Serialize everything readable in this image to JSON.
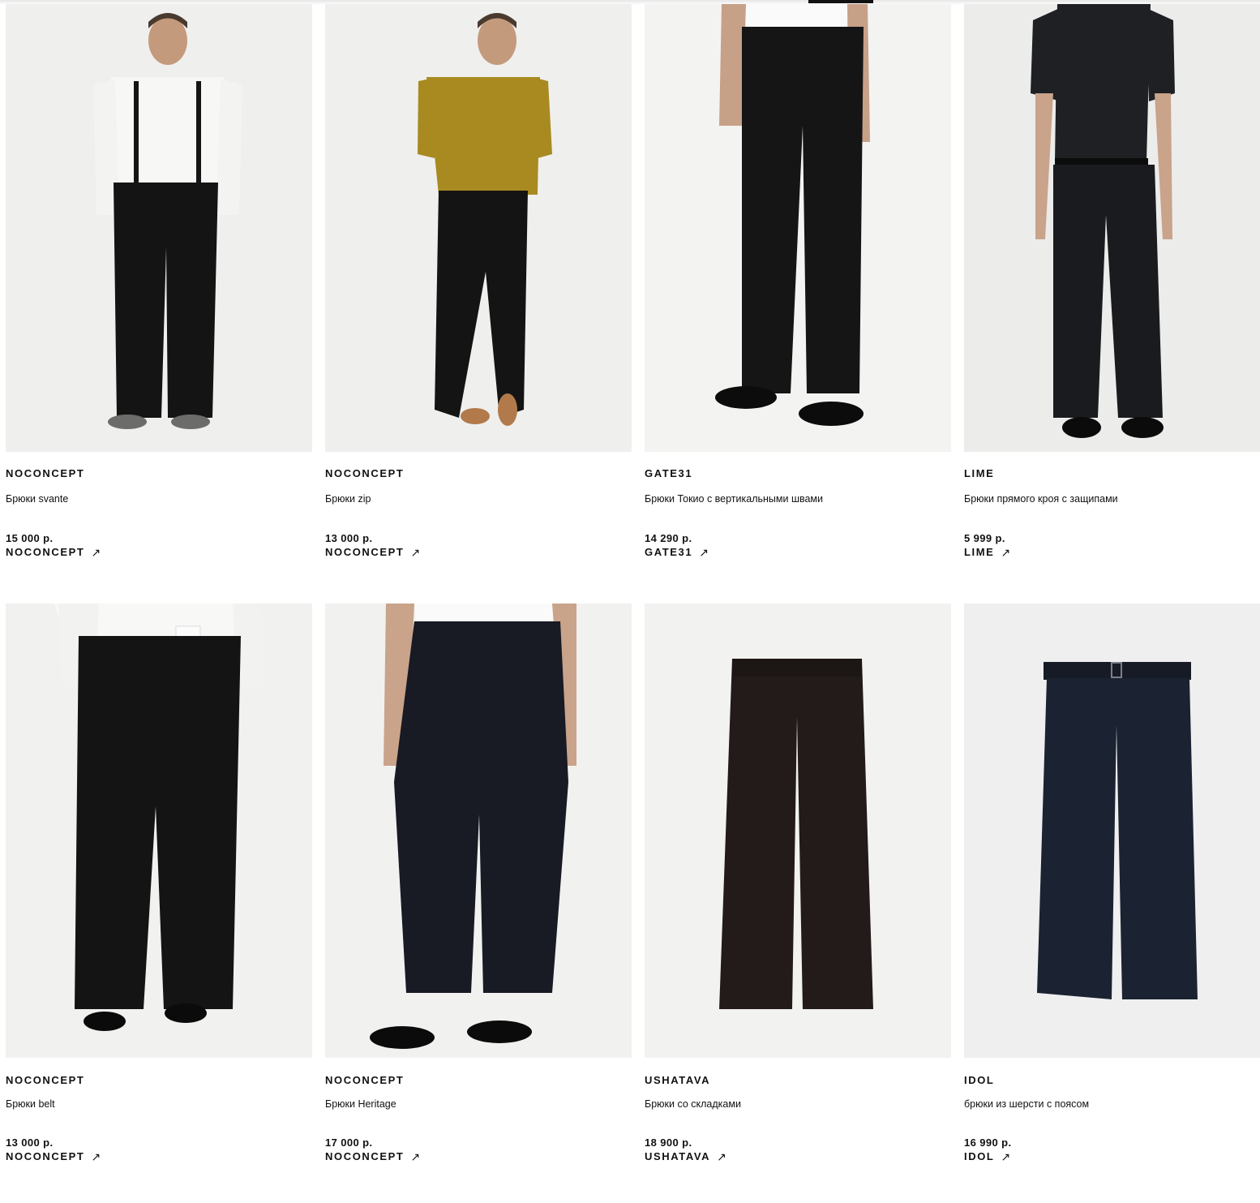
{
  "currency": "р.",
  "products": [
    {
      "brand": "NOCONCEPT",
      "name": "Брюки svante",
      "price": "15 000 р.",
      "shop_label": "NOCONCEPT",
      "photo": "model-white-shirt-suspenders-black-trousers"
    },
    {
      "brand": "NOCONCEPT",
      "name": "Брюки zip",
      "price": "13 000 р.",
      "shop_label": "NOCONCEPT",
      "photo": "model-mustard-tee-black-trousers"
    },
    {
      "brand": "GATE31",
      "name": "Брюки Токио с вертикальными швами",
      "price": "14 290 р.",
      "shop_label": "GATE31",
      "photo": "black-wide-trousers-waist-down"
    },
    {
      "brand": "LIME",
      "name": "Брюки прямого кроя с защипами",
      "price": "5 999 р.",
      "shop_label": "LIME",
      "photo": "model-black-polo-black-trousers"
    },
    {
      "brand": "NOCONCEPT",
      "name": "Брюки belt",
      "price": "13 000 р.",
      "shop_label": "NOCONCEPT",
      "photo": "wide-pleated-black-trousers-closeup"
    },
    {
      "brand": "NOCONCEPT",
      "name": "Брюки Heritage",
      "price": "17 000 р.",
      "shop_label": "NOCONCEPT",
      "photo": "balloon-black-trousers-loafers"
    },
    {
      "brand": "USHATAVA",
      "name": "Брюки со складками",
      "price": "18 900 р.",
      "shop_label": "USHATAVA",
      "photo": "flatlay-dark-brown-trousers"
    },
    {
      "brand": "IDOL",
      "name": "брюки из шерсти с поясом",
      "price": "16 990 р.",
      "shop_label": "IDOL",
      "photo": "flatlay-navy-wool-trousers-belt"
    }
  ],
  "icons": {
    "external_link": "arrow-up-right-icon"
  },
  "colors": {
    "text": "#111111",
    "photo_bg": "#f1f1f0"
  }
}
